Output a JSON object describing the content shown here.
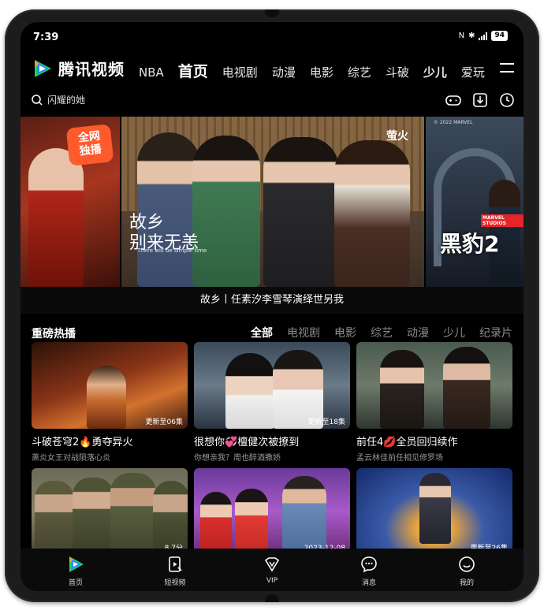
{
  "status_bar": {
    "time": "7:39",
    "battery": "94"
  },
  "header": {
    "app_name": "腾讯视频",
    "nav": [
      "NBA",
      "首页",
      "电视剧",
      "动漫",
      "电影",
      "综艺",
      "斗破",
      "少儿",
      "爱玩"
    ]
  },
  "search": {
    "placeholder": "闪耀的她"
  },
  "banner": {
    "left_badge": "全网\n独播",
    "main_title_line1": "故乡",
    "main_title_line2": "别来无恙",
    "main_subtitle": "There will be simple time",
    "main_brand": "萤火",
    "right_title": "黑豹2",
    "right_marvel": "MARVEL STUDIOS",
    "right_copyright": "© 2022 MARVEL",
    "caption": "故乡丨任素汐李雪琴演绎世另我"
  },
  "section": {
    "title": "重磅热播",
    "filters": [
      "全部",
      "电视剧",
      "电影",
      "综艺",
      "动漫",
      "少儿",
      "纪录片"
    ]
  },
  "cards": [
    {
      "title_pre": "斗破苍穹2",
      "emoji": "🔥",
      "title_post": "勇夺异火",
      "subtitle": "萧炎女王对战陨落心炎",
      "badge": "更新至06集"
    },
    {
      "title_pre": "很想你",
      "emoji": "💞",
      "title_post": "檀健次被撩到",
      "subtitle": "你想亲我？周也醉酒撒娇",
      "badge": "更新至18集"
    },
    {
      "title_pre": "前任4",
      "emoji": "💋",
      "title_post": "全员回归续作",
      "subtitle": "孟云林佳前任相见修罗场",
      "badge": ""
    },
    {
      "badge": "8.7分"
    },
    {
      "badge": "2023-12-08"
    },
    {
      "badge": "更新至26集"
    }
  ],
  "tabbar": [
    "首页",
    "短视频",
    "VIP",
    "消息",
    "我的"
  ],
  "colors": {
    "accent_blue": "#2c8bff",
    "accent_green": "#1fcf6f",
    "accent_orange": "#ff5a2c"
  }
}
